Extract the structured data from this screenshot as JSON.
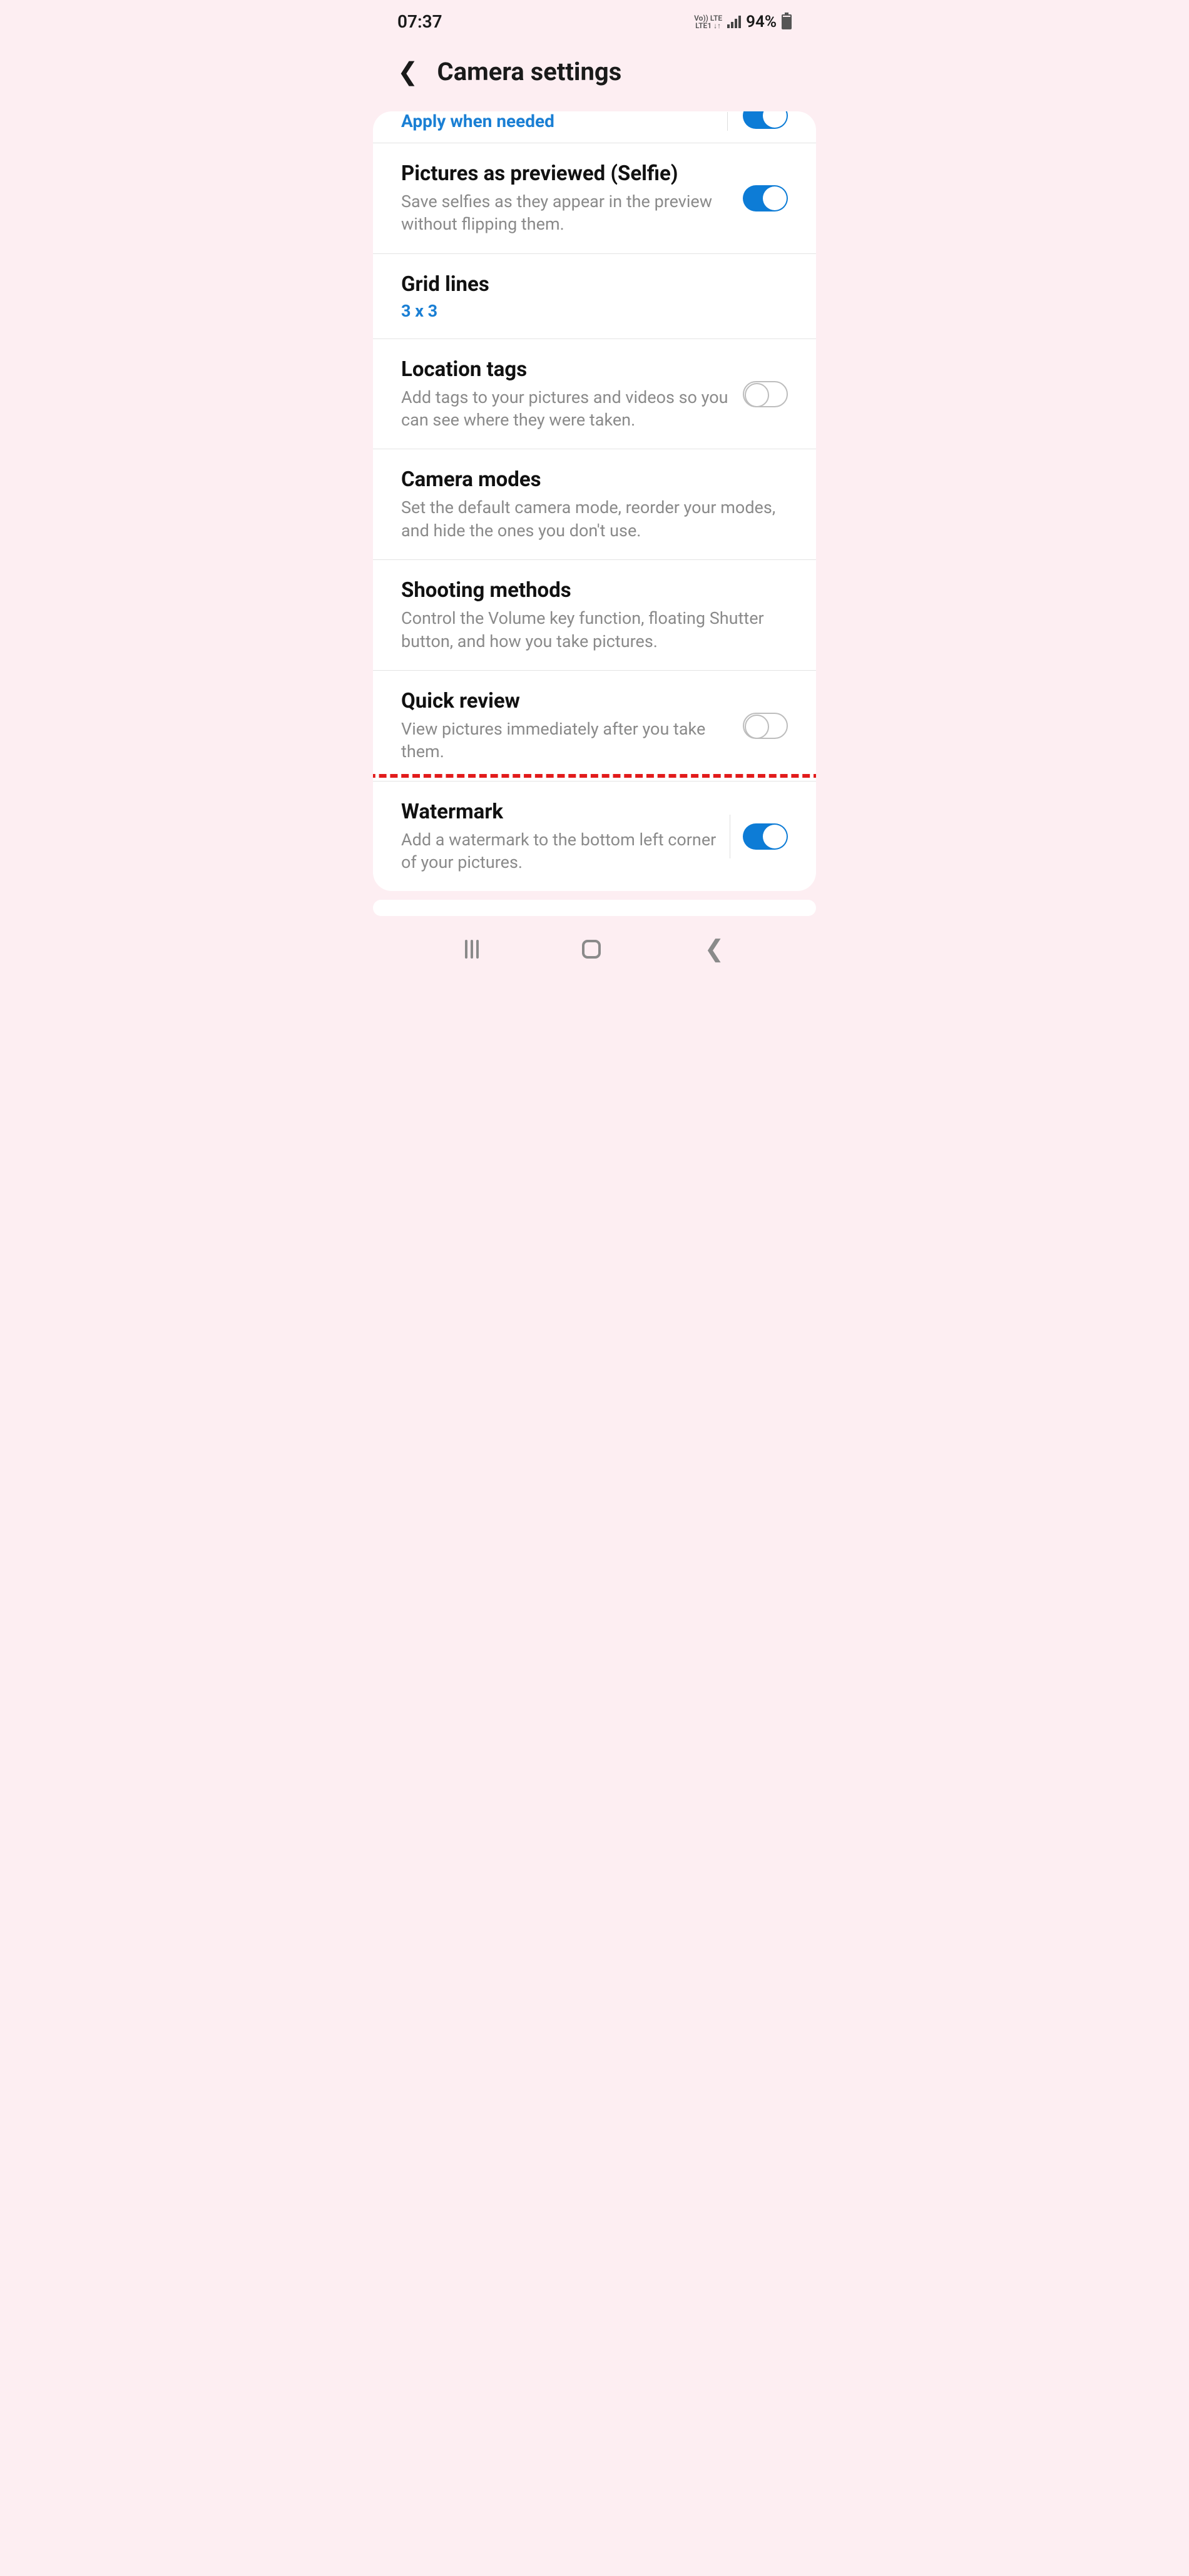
{
  "status": {
    "time": "07:37",
    "lte_top": "Vo)) LTE",
    "lte_bottom": "LTE1 ↓↑",
    "battery_pct": "94%"
  },
  "header": {
    "title": "Camera settings"
  },
  "rows": {
    "cutoff_label": "Apply when needed",
    "selfie": {
      "title": "Pictures as previewed (Selfie)",
      "sub": "Save selfies as they appear in the preview without flipping them."
    },
    "grid": {
      "title": "Grid lines",
      "value": "3 x 3"
    },
    "location": {
      "title": "Location tags",
      "sub": "Add tags to your pictures and videos so you can see where they were taken."
    },
    "modes": {
      "title": "Camera modes",
      "sub": "Set the default camera mode, reorder your modes, and hide the ones you don't use."
    },
    "shooting": {
      "title": "Shooting methods",
      "sub": "Control the Volume key function, floating Shutter button, and how you take pictures."
    },
    "quick": {
      "title": "Quick review",
      "sub": "View pictures immediately after you take them."
    },
    "watermark": {
      "title": "Watermark",
      "sub": "Add a watermark to the bottom left corner of your pictures."
    }
  }
}
